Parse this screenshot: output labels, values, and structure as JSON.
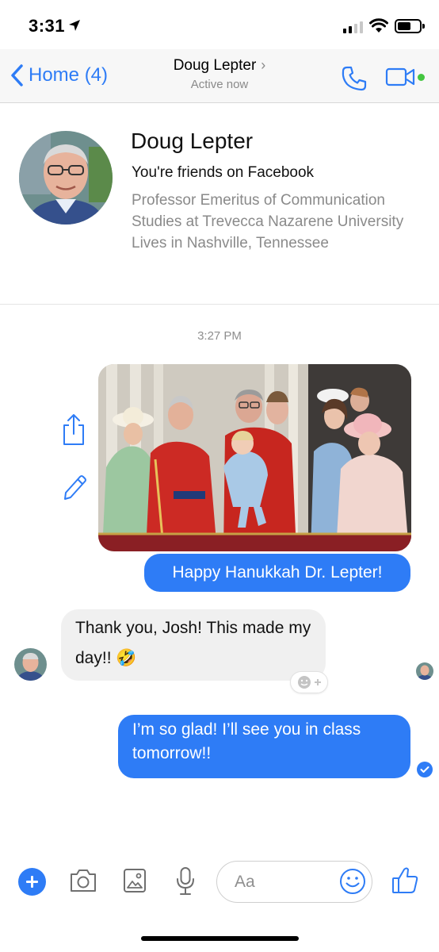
{
  "status_bar": {
    "time": "3:31",
    "signal_bars": 4,
    "signal_active": 2
  },
  "nav": {
    "back_label": "Home (4)",
    "contact_name": "Doug Lepter",
    "chevron": "›",
    "status": "Active now"
  },
  "profile": {
    "name": "Doug Lepter",
    "friends_line": "You're friends on Facebook",
    "bio_lines": [
      "Professor Emeritus of Communication Studies at Trevecca Nazarene University",
      "Lives in Nashville, Tennessee"
    ]
  },
  "thread": {
    "timestamp": "3:27 PM",
    "messages": [
      {
        "from": "me",
        "type": "photo"
      },
      {
        "from": "me",
        "text": "Happy Hanukkah Dr. Lepter!"
      },
      {
        "from": "them",
        "text": "Thank you, Josh! This made my day!! 🤣"
      },
      {
        "from": "me",
        "text": "I’m so glad!  I’ll see you in class tomorrow!!"
      }
    ]
  },
  "composer": {
    "placeholder": "Aa"
  },
  "colors": {
    "accent": "#2e7cf6",
    "active_green": "#44c640",
    "incoming_bubble": "#f0f0f0"
  },
  "icons": [
    "location-arrow-icon",
    "wifi-icon",
    "battery-icon",
    "back-chevron-icon",
    "phone-icon",
    "video-camera-icon",
    "share-icon",
    "pencil-icon",
    "add-reaction-icon",
    "sent-check-icon",
    "plus-icon",
    "camera-icon",
    "gallery-icon",
    "microphone-icon",
    "emoji-icon",
    "thumbs-up-icon"
  ]
}
